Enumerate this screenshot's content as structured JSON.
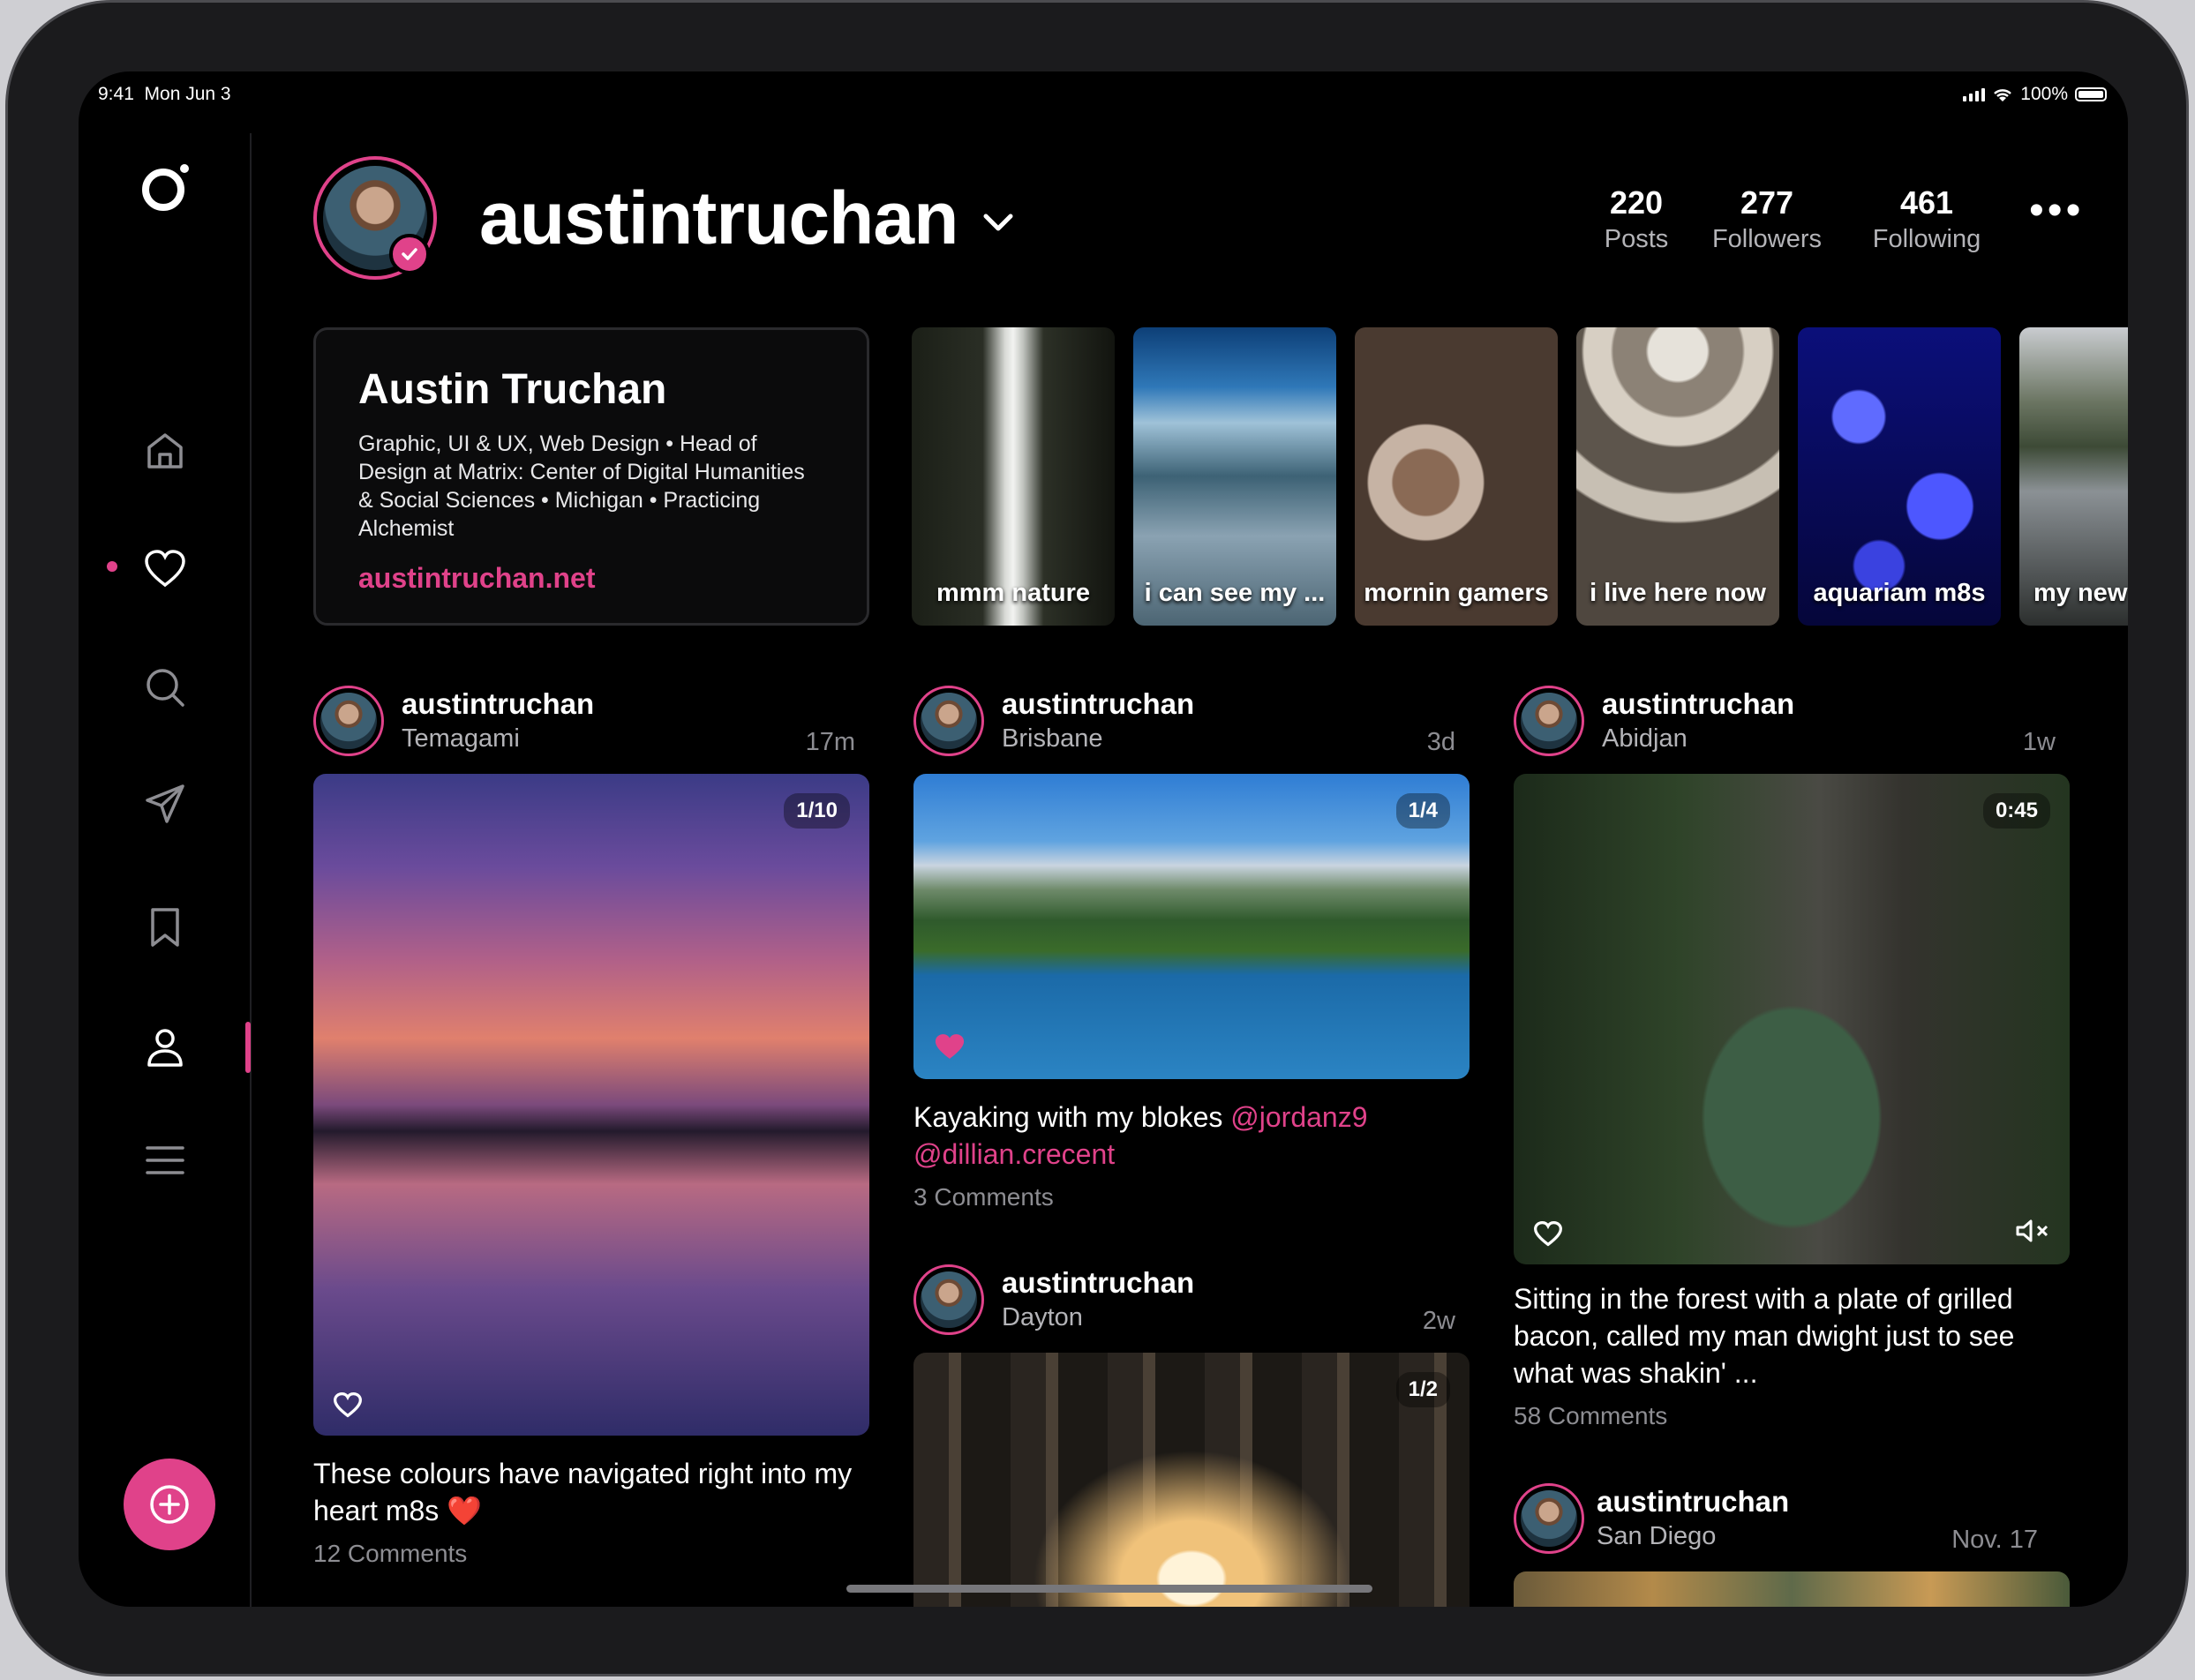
{
  "status": {
    "time": "9:41",
    "date": "Mon Jun 3",
    "battery": "100%"
  },
  "profile": {
    "username": "austintruchan",
    "stats": [
      {
        "value": "220",
        "label": "Posts"
      },
      {
        "value": "277",
        "label": "Followers"
      },
      {
        "value": "461",
        "label": "Following"
      }
    ],
    "more_label": "•••",
    "name": "Austin Truchan",
    "bio": "Graphic, UI & UX, Web Design • Head of Design at Matrix: Center of Digital Humanities & Social Sciences • Michigan • Practicing Alchemist",
    "website": "austintruchan.net"
  },
  "highlights": [
    {
      "label": "mmm nature"
    },
    {
      "label": "i can see my ..."
    },
    {
      "label": "mornin gamers"
    },
    {
      "label": "i live here now"
    },
    {
      "label": "aquariam m8s"
    },
    {
      "label": "my new"
    }
  ],
  "posts": [
    {
      "username": "austintruchan",
      "location": "Temagami",
      "ago": "17m",
      "counter": "1/10",
      "caption": "These colours have navigated right into my heart m8s ❤️",
      "comments": "12 Comments"
    },
    {
      "username": "austintruchan",
      "location": "Brisbane",
      "ago": "3d",
      "counter": "1/4",
      "caption": "Kayaking with my blokes",
      "mention1": "@jordanz9",
      "mention2": "@dillian.crecent",
      "comments": "3 Comments"
    },
    {
      "username": "austintruchan",
      "location": "Abidjan",
      "ago": "1w",
      "counter": "0:45",
      "caption": "Sitting in the forest with a plate of grilled bacon, called my man dwight just to see what was shakin' ...",
      "comments": "58 Comments"
    },
    {
      "username": "austintruchan",
      "location": "Dayton",
      "ago": "2w",
      "counter": "1/2"
    },
    {
      "username": "austintruchan",
      "location": "San Diego",
      "ago": "Nov. 17"
    }
  ],
  "accent_color": "#e0428a",
  "icons": {
    "sidebar": [
      "logo-icon",
      "home-icon",
      "heart-icon",
      "search-icon",
      "send-icon",
      "bookmark-icon",
      "profile-icon",
      "menu-icon",
      "add-icon"
    ]
  }
}
